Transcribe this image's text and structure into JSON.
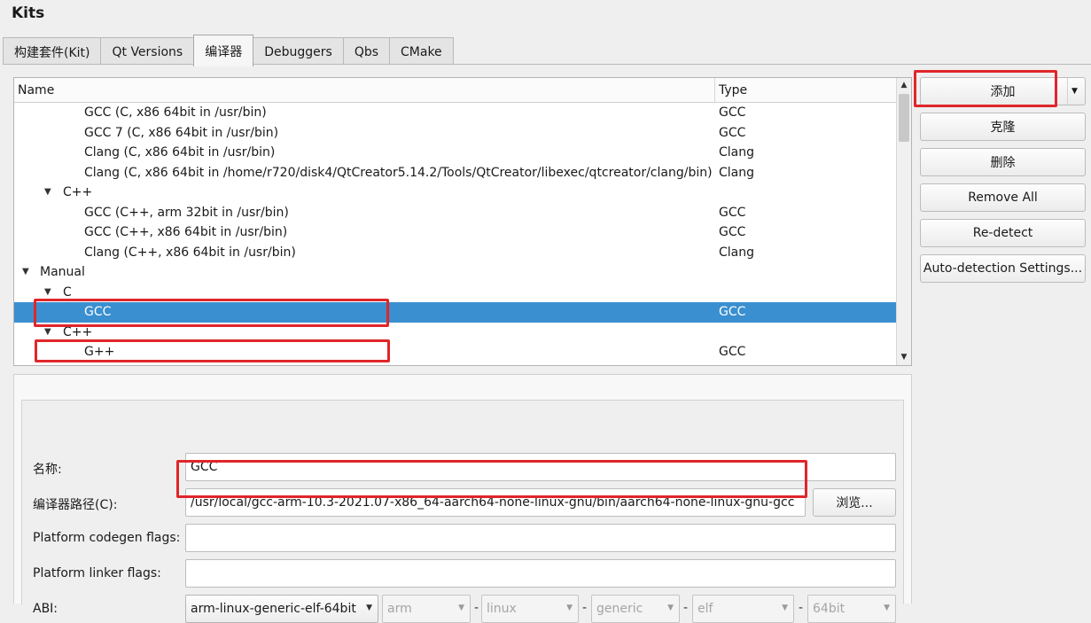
{
  "window": {
    "title": "Kits"
  },
  "tabs": [
    {
      "label": "构建套件(Kit)"
    },
    {
      "label": "Qt Versions"
    },
    {
      "label": "编译器",
      "active": true
    },
    {
      "label": "Debuggers"
    },
    {
      "label": "Qbs"
    },
    {
      "label": "CMake"
    }
  ],
  "tree": {
    "headers": {
      "name": "Name",
      "type": "Type"
    },
    "rows": [
      {
        "name": "GCC (C, x86 64bit in /usr/bin)",
        "type": "GCC"
      },
      {
        "name": "GCC 7 (C, x86 64bit in /usr/bin)",
        "type": "GCC"
      },
      {
        "name": "Clang (C, x86 64bit in /usr/bin)",
        "type": "Clang"
      },
      {
        "name": "Clang (C, x86 64bit in /home/r720/disk4/QtCreator5.14.2/Tools/QtCreator/libexec/qtcreator/clang/bin)",
        "type": "Clang"
      },
      {
        "name": "C++",
        "type": ""
      },
      {
        "name": "GCC (C++, arm 32bit in /usr/bin)",
        "type": "GCC"
      },
      {
        "name": "GCC (C++, x86 64bit in /usr/bin)",
        "type": "GCC"
      },
      {
        "name": "Clang (C++, x86 64bit in /usr/bin)",
        "type": "Clang"
      },
      {
        "name": "Manual",
        "type": ""
      },
      {
        "name": "C",
        "type": ""
      },
      {
        "name": "GCC",
        "type": "GCC"
      },
      {
        "name": "C++",
        "type": ""
      },
      {
        "name": "G++",
        "type": "GCC"
      }
    ]
  },
  "side_buttons": {
    "add": "添加",
    "clone": "克隆",
    "delete": "删除",
    "remove_all": "Remove All",
    "redetect": "Re-detect",
    "auto_detection": "Auto-detection Settings..."
  },
  "details": {
    "name_label": "名称:",
    "name_value": "GCC",
    "path_label": "编译器路径(C):",
    "path_value": "/usr/local/gcc-arm-10.3-2021.07-x86_64-aarch64-none-linux-gnu/bin/aarch64-none-linux-gnu-gcc",
    "browse": "浏览...",
    "codegen_label": "Platform codegen flags:",
    "codegen_value": "",
    "linker_label": "Platform linker flags:",
    "linker_value": "",
    "abi_label": "ABI:",
    "abi_main": "arm-linux-generic-elf-64bit",
    "abi_arch": "arm",
    "abi_os": "linux",
    "abi_flavor": "generic",
    "abi_format": "elf",
    "abi_width": "64bit",
    "separator": "-"
  },
  "colors": {
    "selection": "#3a8fd0",
    "highlight": "#e0262a"
  }
}
